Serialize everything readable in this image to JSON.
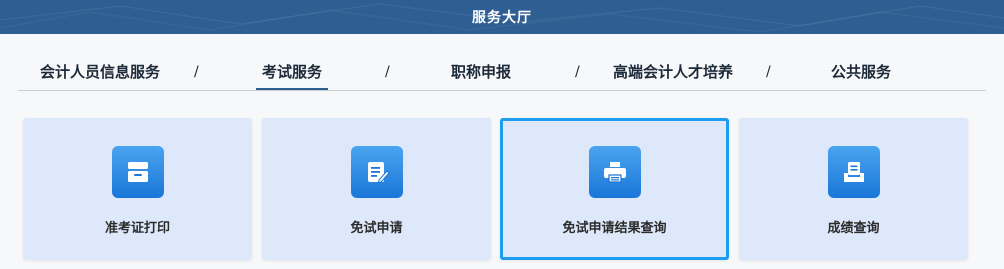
{
  "header": {
    "title": "服务大厅"
  },
  "nav": {
    "separator": "/",
    "items": [
      {
        "label": "会计人员信息服务"
      },
      {
        "label": "考试服务"
      },
      {
        "label": "职称申报"
      },
      {
        "label": "高端会计人才培养"
      },
      {
        "label": "公共服务"
      }
    ],
    "active_item": "考试服务"
  },
  "cards": [
    {
      "label": "准考证打印",
      "icon": "archive-box-icon"
    },
    {
      "label": "免试申请",
      "icon": "edit-document-icon"
    },
    {
      "label": "免试申请结果查询",
      "icon": "printer-icon",
      "selected": true
    },
    {
      "label": "成绩查询",
      "icon": "scores-tray-icon"
    }
  ],
  "colors": {
    "header_bg": "#2f5f92",
    "card_bg": "#dde9fa",
    "icon_blue": "#1a76d8",
    "selected_border": "#1e9df0"
  }
}
